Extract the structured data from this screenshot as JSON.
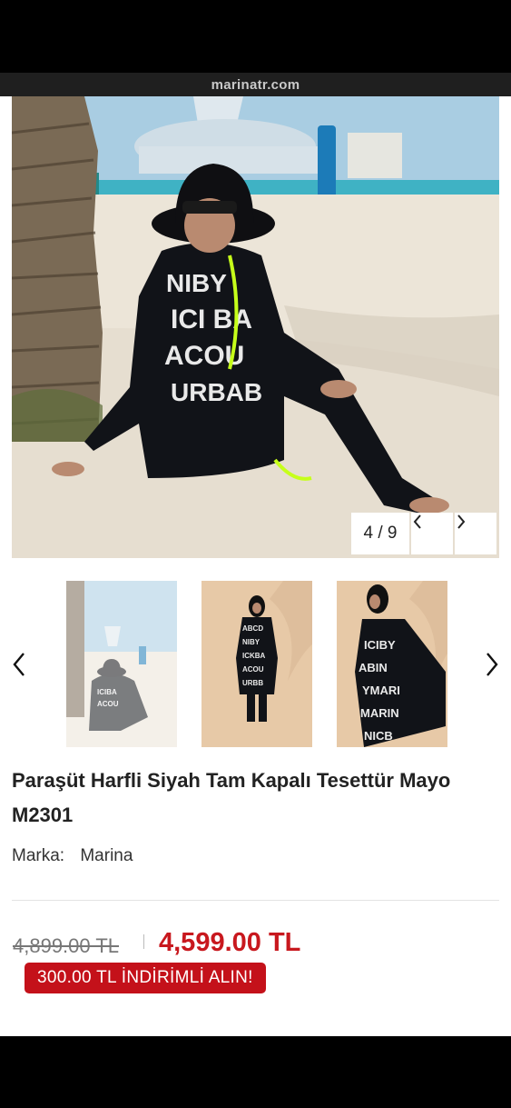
{
  "browser": {
    "url": "marinatr.com"
  },
  "gallery": {
    "counter": "4 / 9",
    "thumbnail_count": 3
  },
  "product": {
    "title": "Paraşüt Harfli Siyah Tam Kapalı Tesettür Mayo M2301",
    "brand_label": "Marka:",
    "brand_value": "Marina",
    "old_price": "4,899.00 TL",
    "new_price": "4,599.00 TL",
    "discount_badge": "300.00 TL İNDİRİMLİ ALIN!"
  },
  "colors": {
    "price_red": "#c8181e",
    "badge_red": "#c4111a",
    "background": "#ffffff"
  },
  "icons": [
    "chevron-left-icon",
    "chevron-right-icon"
  ]
}
